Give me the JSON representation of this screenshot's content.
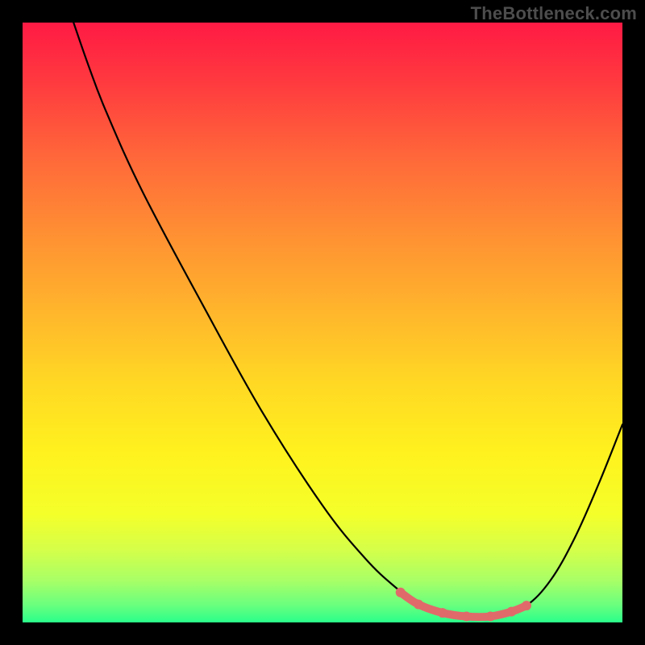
{
  "watermark": "TheBottleneck.com",
  "gradient": {
    "stops": [
      {
        "offset": 0.0,
        "color": "#ff1a44"
      },
      {
        "offset": 0.1,
        "color": "#ff3a3f"
      },
      {
        "offset": 0.22,
        "color": "#ff663a"
      },
      {
        "offset": 0.35,
        "color": "#ff8f33"
      },
      {
        "offset": 0.48,
        "color": "#ffb52c"
      },
      {
        "offset": 0.6,
        "color": "#ffd824"
      },
      {
        "offset": 0.72,
        "color": "#fff21e"
      },
      {
        "offset": 0.82,
        "color": "#f4ff2a"
      },
      {
        "offset": 0.88,
        "color": "#d4ff4a"
      },
      {
        "offset": 0.93,
        "color": "#a8ff66"
      },
      {
        "offset": 0.97,
        "color": "#6cff7e"
      },
      {
        "offset": 1.0,
        "color": "#2aff8a"
      }
    ]
  },
  "curve": {
    "stroke": "#000000",
    "stroke_width": 2.2,
    "points": [
      {
        "x": 0.085,
        "y": 0.0
      },
      {
        "x": 0.11,
        "y": 0.072
      },
      {
        "x": 0.14,
        "y": 0.15
      },
      {
        "x": 0.2,
        "y": 0.282
      },
      {
        "x": 0.3,
        "y": 0.47
      },
      {
        "x": 0.4,
        "y": 0.65
      },
      {
        "x": 0.5,
        "y": 0.805
      },
      {
        "x": 0.57,
        "y": 0.892
      },
      {
        "x": 0.62,
        "y": 0.94
      },
      {
        "x": 0.66,
        "y": 0.968
      },
      {
        "x": 0.7,
        "y": 0.984
      },
      {
        "x": 0.74,
        "y": 0.99
      },
      {
        "x": 0.8,
        "y": 0.988
      },
      {
        "x": 0.84,
        "y": 0.972
      },
      {
        "x": 0.88,
        "y": 0.93
      },
      {
        "x": 0.92,
        "y": 0.86
      },
      {
        "x": 0.96,
        "y": 0.77
      },
      {
        "x": 1.0,
        "y": 0.67
      }
    ]
  },
  "highlight": {
    "stroke": "#e06a6a",
    "stroke_width": 10,
    "dot_radius": 6,
    "points": [
      {
        "x": 0.63,
        "y": 0.95
      },
      {
        "x": 0.66,
        "y": 0.97
      },
      {
        "x": 0.7,
        "y": 0.984
      },
      {
        "x": 0.74,
        "y": 0.99
      },
      {
        "x": 0.78,
        "y": 0.99
      },
      {
        "x": 0.815,
        "y": 0.982
      },
      {
        "x": 0.84,
        "y": 0.972
      }
    ]
  },
  "chart_data": {
    "type": "line",
    "title": "",
    "xlabel": "",
    "ylabel": "",
    "xlim": [
      0,
      1
    ],
    "ylim": [
      0,
      1
    ],
    "grid": false,
    "legend": false,
    "series": [
      {
        "name": "bottleneck-curve",
        "x": [
          0.085,
          0.11,
          0.14,
          0.2,
          0.3,
          0.4,
          0.5,
          0.57,
          0.62,
          0.66,
          0.7,
          0.74,
          0.8,
          0.84,
          0.88,
          0.92,
          0.96,
          1.0
        ],
        "y": [
          1.0,
          0.928,
          0.85,
          0.718,
          0.53,
          0.35,
          0.195,
          0.108,
          0.06,
          0.032,
          0.016,
          0.01,
          0.012,
          0.028,
          0.07,
          0.14,
          0.23,
          0.33
        ]
      },
      {
        "name": "optimal-range-highlight",
        "x": [
          0.63,
          0.66,
          0.7,
          0.74,
          0.78,
          0.815,
          0.84
        ],
        "y": [
          0.05,
          0.03,
          0.016,
          0.01,
          0.01,
          0.018,
          0.028
        ]
      }
    ],
    "annotations": [
      {
        "text": "TheBottleneck.com",
        "pos": "top-right"
      }
    ]
  }
}
